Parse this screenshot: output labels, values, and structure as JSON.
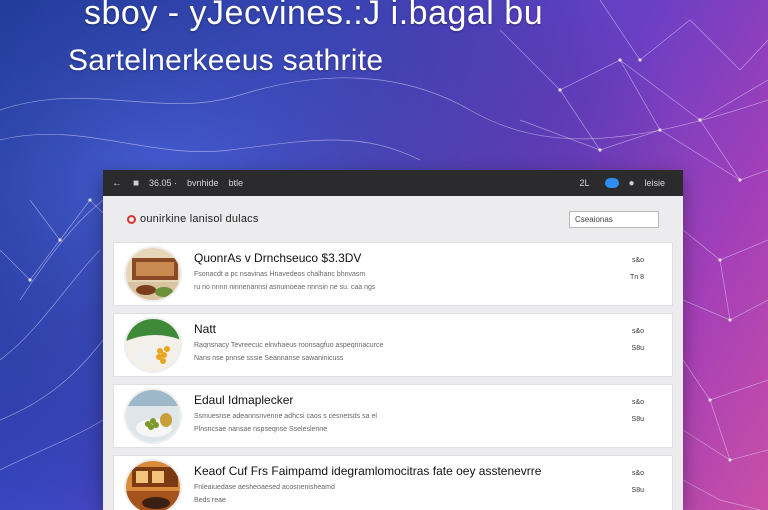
{
  "hero": {
    "headline": "sboy - yJecvines.:J i.bagal bu",
    "subline": "Sartelnerkeeus sathrite"
  },
  "topbar": {
    "nav1": "36.05 ·",
    "nav2": "bvnhide",
    "nav3": "btle",
    "right_label": "2L",
    "account": "leisie"
  },
  "toolbar": {
    "brand": "ounirkine lanisol dulacs",
    "search_value": "Cseaionas"
  },
  "listings": [
    {
      "title": "QuonrAs v Drnchseuco $3.3DV",
      "line1": "Fsonacdt a pc nsavinas Hnavedeos chalhanc bhnvasm",
      "line2": "ru no nnnn ninnenannsi asnuinoeae nnnsin ne su. caa ngs",
      "meta1": "s&o",
      "meta2": "Tn 8"
    },
    {
      "title": "Natt",
      "line1": "Raqnsnacy Tevreecuc elnvhaeus roonsagfuo aspeqrinacurce",
      "line2": "Nans nse pnnse sssie Seannanse sawaninicuss",
      "meta1": "s&o",
      "meta2": "S8u"
    },
    {
      "title": "Edaul Idmaplecker",
      "line1": "Ssmuesnse adeannsnvenne adhcsi caos s cesnetsds sa el",
      "line2": "Plnsncsae nansae nspseqnse Sseleslenne",
      "meta1": "s&o",
      "meta2": "S8u"
    },
    {
      "title": "Keaof Cuf Frs Faimpamd idegramlomocitras fate oey asstenevrre",
      "line1": "Fnleaiuedase aesheoaesed acosnenisheamd",
      "line2": "Beds reae",
      "meta1": "s&o",
      "meta2": "S8u"
    }
  ]
}
